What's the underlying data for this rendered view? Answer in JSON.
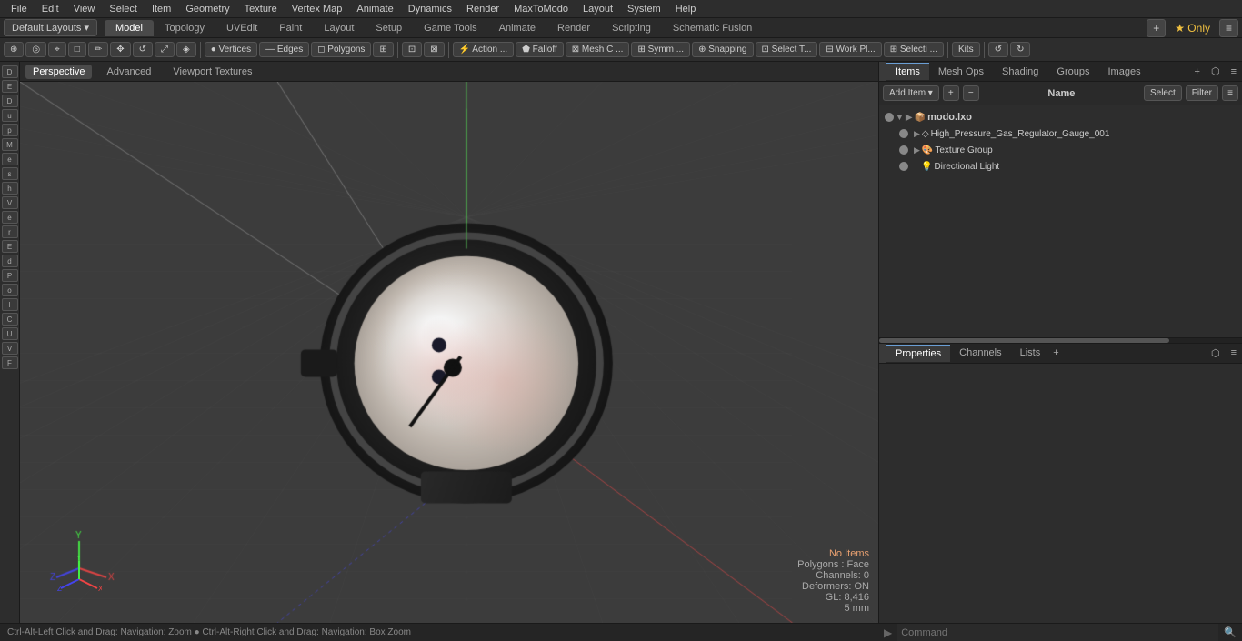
{
  "menubar": {
    "items": [
      "File",
      "Edit",
      "View",
      "Select",
      "Item",
      "Geometry",
      "Texture",
      "Vertex Map",
      "Animate",
      "Dynamics",
      "Render",
      "MaxToModo",
      "Layout",
      "System",
      "Help"
    ]
  },
  "layout_bar": {
    "default_layouts": "Default Layouts ▾",
    "tabs": [
      "Model",
      "Topology",
      "UVEdit",
      "Paint",
      "Layout",
      "Setup",
      "Game Tools",
      "Animate",
      "Render",
      "Scripting",
      "Schematic Fusion"
    ],
    "active_tab": "Model",
    "star_label": "★ Only",
    "plus_label": "+"
  },
  "tools_bar": {
    "buttons": [
      {
        "label": "⊕",
        "name": "add-btn"
      },
      {
        "label": "⊙",
        "name": "circle-btn"
      },
      {
        "label": "◇",
        "name": "diamond-btn"
      },
      {
        "label": "□",
        "name": "square-btn"
      },
      {
        "label": "⬡",
        "name": "hex-btn"
      },
      {
        "label": "▷",
        "name": "tri-btn"
      },
      {
        "label": "⊡",
        "name": "grid-btn"
      },
      {
        "label": "↺",
        "name": "rotate-btn"
      },
      {
        "label": "◉",
        "name": "circle2-btn"
      },
      {
        "label": "◈",
        "name": "diamond2-btn"
      },
      {
        "label": "Vertices",
        "name": "vertices-btn"
      },
      {
        "label": "Edges",
        "name": "edges-btn"
      },
      {
        "label": "Polygons",
        "name": "polygons-btn"
      },
      {
        "label": "▣",
        "name": "mesh-btn"
      },
      {
        "label": "⊞",
        "name": "grid2-btn"
      },
      {
        "label": "⊠",
        "name": "xgrid-btn"
      },
      {
        "label": "Action ...",
        "name": "action-btn"
      },
      {
        "label": "Falloff",
        "name": "falloff-btn"
      },
      {
        "label": "Mesh C ...",
        "name": "meshc-btn"
      },
      {
        "label": "Symm ...",
        "name": "symm-btn"
      },
      {
        "label": "Snapping",
        "name": "snapping-btn"
      },
      {
        "label": "Select T...",
        "name": "selectt-btn"
      },
      {
        "label": "Work Pl...",
        "name": "workpl-btn"
      },
      {
        "label": "Selecti ...",
        "name": "selecti-btn"
      },
      {
        "label": "Kits",
        "name": "kits-btn"
      },
      {
        "label": "↺",
        "name": "undo-btn"
      },
      {
        "label": "↻",
        "name": "redo-btn"
      }
    ]
  },
  "viewport": {
    "tabs": [
      "Perspective",
      "Advanced",
      "Viewport Textures"
    ],
    "active_tab": "Perspective"
  },
  "right_panel": {
    "tabs": [
      "Items",
      "Mesh Ops",
      "Shading",
      "Groups",
      "Images"
    ],
    "active_tab": "Items",
    "add_item_label": "Add Item",
    "select_label": "Select",
    "filter_label": "Filter",
    "name_header": "Name",
    "items": [
      {
        "id": "modo-lxo",
        "label": "modo.lxo",
        "icon": "📦",
        "indent": 0,
        "has_arrow": true,
        "expanded": true
      },
      {
        "id": "gauge",
        "label": "High_Pressure_Gas_Regulator_Gauge_001",
        "icon": "🔷",
        "indent": 1,
        "has_arrow": true,
        "expanded": false
      },
      {
        "id": "texture-group",
        "label": "Texture Group",
        "icon": "🎨",
        "indent": 1,
        "has_arrow": true,
        "expanded": false
      },
      {
        "id": "directional-light",
        "label": "Directional Light",
        "icon": "💡",
        "indent": 1,
        "has_arrow": false,
        "expanded": false
      }
    ],
    "bottom_tabs": [
      "Properties",
      "Channels",
      "Lists"
    ],
    "active_bottom_tab": "Properties",
    "bottom_tab_add": "+"
  },
  "status_bar": {
    "left_text": "Ctrl-Alt-Left Click and Drag: Navigation: Zoom  ●  Ctrl-Alt-Right Click and Drag: Navigation: Box Zoom",
    "command_placeholder": "Command"
  },
  "viewport_info": {
    "no_items": "No Items",
    "polygons": "Polygons : Face",
    "channels": "Channels: 0",
    "deformers": "Deformers: ON",
    "gl": "GL: 8,416",
    "units": "5 mm"
  }
}
